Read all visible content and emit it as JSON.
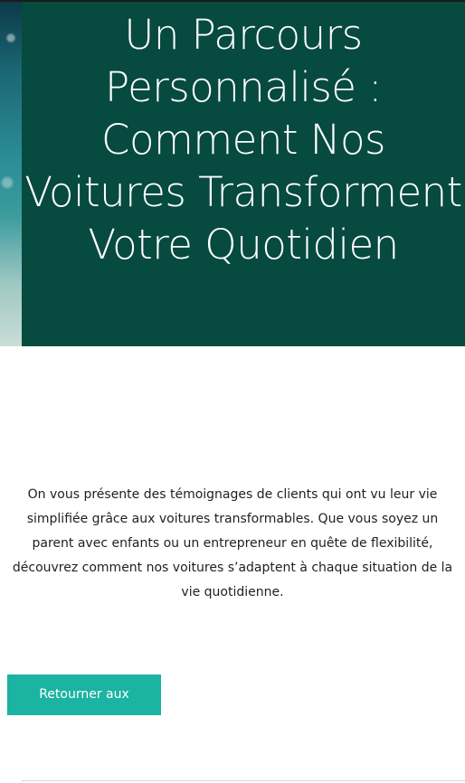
{
  "hero": {
    "title": "Un Parcours Personnalisé : Comment Nos Voitures Transforment Votre Quotidien"
  },
  "article": {
    "intro": "On vous présente des témoignages de clients qui ont vu leur vie simplifiée grâce aux voitures transformables. Que vous soyez un parent avec enfants ou un entrepreneur en quête de flexibilité, découvrez comment nos voitures s’adaptent à chaque situation de la vie quotidienne."
  },
  "actions": {
    "back_label": "Retourner aux nouvelles"
  },
  "colors": {
    "hero_panel": "#064a40",
    "button_bg": "#1bb3a1",
    "text": "#1f1f1f"
  }
}
